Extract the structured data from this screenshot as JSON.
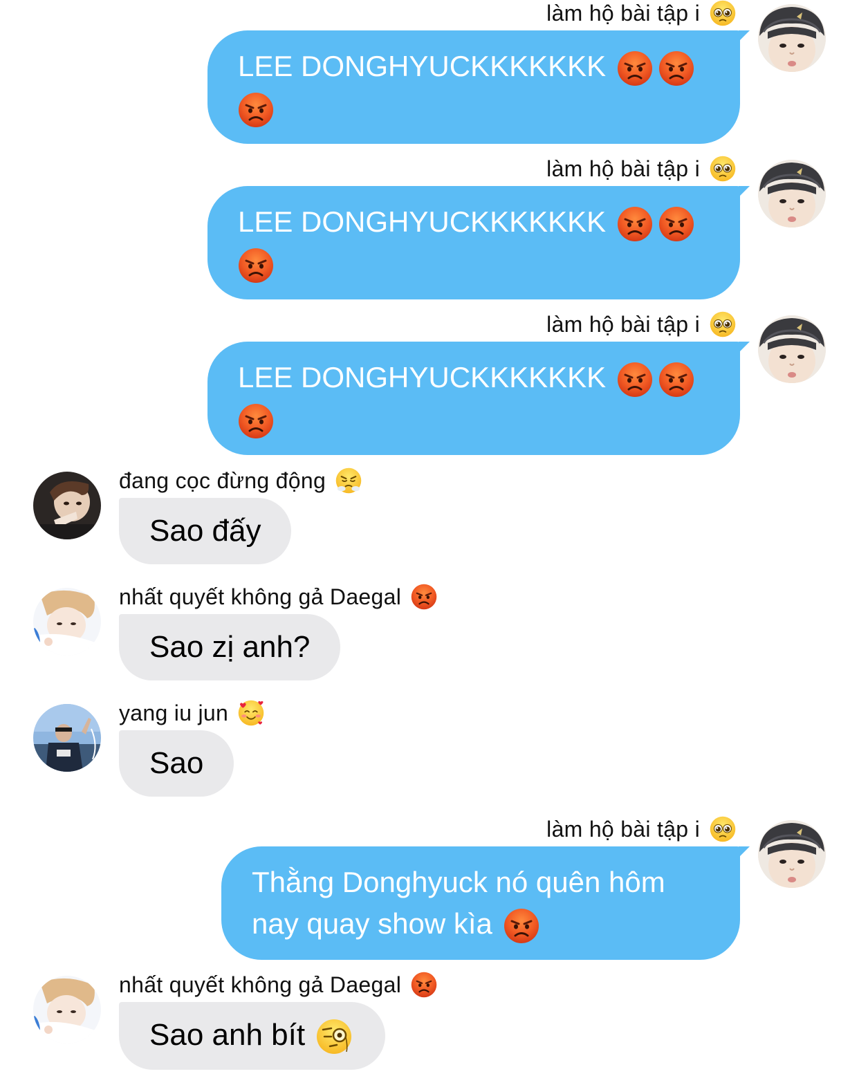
{
  "conversation": {
    "messages": [
      {
        "id": "m1",
        "side": "out",
        "sender": "làm hộ bài tập i",
        "sender_emoji": "pleading-face-icon",
        "text": "LEE DONGHYUCKKKKKKK",
        "trailing_emojis": [
          "angry-face-icon",
          "angry-face-icon",
          "angry-face-icon"
        ]
      },
      {
        "id": "m2",
        "side": "out",
        "sender": "làm hộ bài tập i",
        "sender_emoji": "pleading-face-icon",
        "text": "LEE DONGHYUCKKKKKKK",
        "trailing_emojis": [
          "angry-face-icon",
          "angry-face-icon",
          "angry-face-icon"
        ]
      },
      {
        "id": "m3",
        "side": "out",
        "sender": "làm hộ bài tập i",
        "sender_emoji": "pleading-face-icon",
        "text": "LEE DONGHYUCKKKKKKK",
        "trailing_emojis": [
          "angry-face-icon",
          "angry-face-icon",
          "angry-face-icon"
        ]
      },
      {
        "id": "m4",
        "side": "in",
        "sender": "đang cọc đừng động",
        "sender_emoji": "steam-nose-face-icon",
        "text": "Sao đấy",
        "trailing_emojis": []
      },
      {
        "id": "m5",
        "side": "in",
        "sender": "nhất quyết không gả Daegal",
        "sender_emoji": "angry-face-icon",
        "text": "Sao zị anh?",
        "trailing_emojis": []
      },
      {
        "id": "m6",
        "side": "in",
        "sender": "yang iu jun",
        "sender_emoji": "smiling-face-hearts-icon",
        "text": "Sao",
        "trailing_emojis": []
      },
      {
        "id": "m7",
        "side": "out",
        "sender": "làm hộ bài tập i",
        "sender_emoji": "pleading-face-icon",
        "text": "Thằng Donghyuck nó quên hôm nay quay show kìa",
        "trailing_emojis": [
          "angry-face-icon"
        ]
      },
      {
        "id": "m8",
        "side": "in",
        "sender": "nhất quyết không gả Daegal",
        "sender_emoji": "angry-face-icon",
        "text": "Sao anh bít",
        "trailing_emojis": [
          "monocle-face-icon"
        ]
      }
    ]
  },
  "colors": {
    "outgoing_bubble": "#5bbcf5",
    "incoming_bubble": "#e9e9eb",
    "background": "#ffffff"
  }
}
